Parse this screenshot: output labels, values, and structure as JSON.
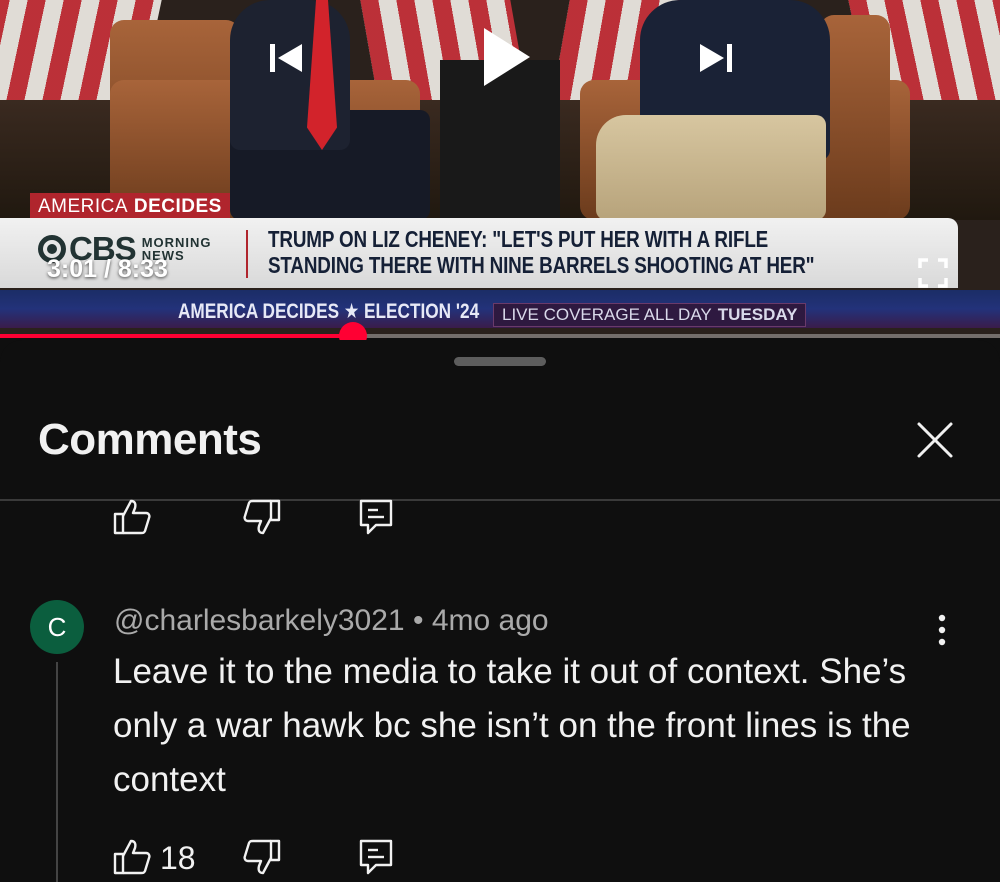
{
  "player": {
    "network_label_light": "AMERICA",
    "network_label_bold": "DECIDES",
    "brand": "CBS",
    "brand_sub": "MORNING NEWS",
    "headline_line1": "TRUMP ON LIZ CHENEY: \"LET'S PUT HER WITH A RIFLE",
    "headline_line2": "STANDING THERE WITH NINE BARRELS SHOOTING AT HER\"",
    "ticker_main": "AMERICA DECIDES ★ ELECTION '24",
    "ticker_live": "LIVE COVERAGE ALL DAY",
    "ticker_live_bold": "TUESDAY",
    "time_display": "3:01 / 8:33",
    "progress_fraction": 0.353,
    "accent_color": "#ff0033",
    "icons": {
      "previous": "skip-previous-icon",
      "play": "play-icon",
      "next": "skip-next-icon",
      "fullscreen": "fullscreen-icon"
    }
  },
  "comments_sheet": {
    "title": "Comments",
    "close_icon": "close-icon",
    "prev_comment_actions": {
      "like_icon": "thumbs-up-icon",
      "dislike_icon": "thumbs-down-icon",
      "reply_icon": "reply-icon"
    },
    "comment": {
      "avatar_letter": "C",
      "avatar_color": "#0b5e3e",
      "author": "@charlesbarkely3021",
      "separator": "•",
      "time_ago": "4mo ago",
      "text": "Leave it to the media to take it out of context. She’s only a war hawk bc she isn’t on the front lines is the context",
      "like_count": "18",
      "more_icon": "more-vertical-icon"
    }
  }
}
